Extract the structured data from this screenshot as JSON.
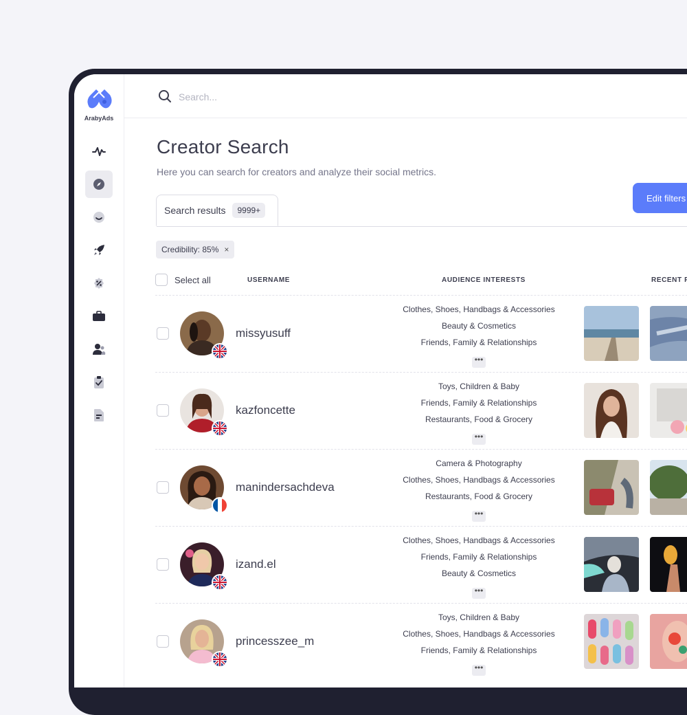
{
  "app": {
    "logo_text": "ArabyAds"
  },
  "search": {
    "placeholder": "Search..."
  },
  "page": {
    "title": "Creator Search",
    "subtitle": "Here you can search for creators and analyze their social metrics."
  },
  "tabs": {
    "results_label": "Search results",
    "results_count": "9999+"
  },
  "actions": {
    "edit_filters": "Edit filters"
  },
  "filters": [
    {
      "label": "Credibility: 85%",
      "close": "×"
    }
  ],
  "table": {
    "select_all": "Select all",
    "columns": {
      "username": "USERNAME",
      "interests": "AUDIENCE INTERESTS",
      "recent": "RECENT PO"
    },
    "more_label": "•••",
    "rows": [
      {
        "username": "missyusuff",
        "country": "uk",
        "interests": [
          "Clothes, Shoes, Handbags & Accessories",
          "Beauty & Cosmetics",
          "Friends, Family & Relationships"
        ]
      },
      {
        "username": "kazfoncette",
        "country": "uk",
        "interests": [
          "Toys, Children & Baby",
          "Friends, Family & Relationships",
          "Restaurants, Food & Grocery"
        ]
      },
      {
        "username": "manindersachdeva",
        "country": "fr",
        "interests": [
          "Camera & Photography",
          "Clothes, Shoes, Handbags & Accessories",
          "Restaurants, Food & Grocery"
        ]
      },
      {
        "username": "izand.el",
        "country": "uk",
        "interests": [
          "Clothes, Shoes, Handbags & Accessories",
          "Friends, Family & Relationships",
          "Beauty & Cosmetics"
        ]
      },
      {
        "username": "princesszee_m",
        "country": "uk",
        "interests": [
          "Toys, Children & Baby",
          "Clothes, Shoes, Handbags & Accessories",
          "Friends, Family & Relationships"
        ]
      }
    ]
  },
  "colors": {
    "accent": "#5b7cfa",
    "text": "#3c3d4e",
    "muted": "#74758a",
    "device_frame": "#1f2030"
  }
}
